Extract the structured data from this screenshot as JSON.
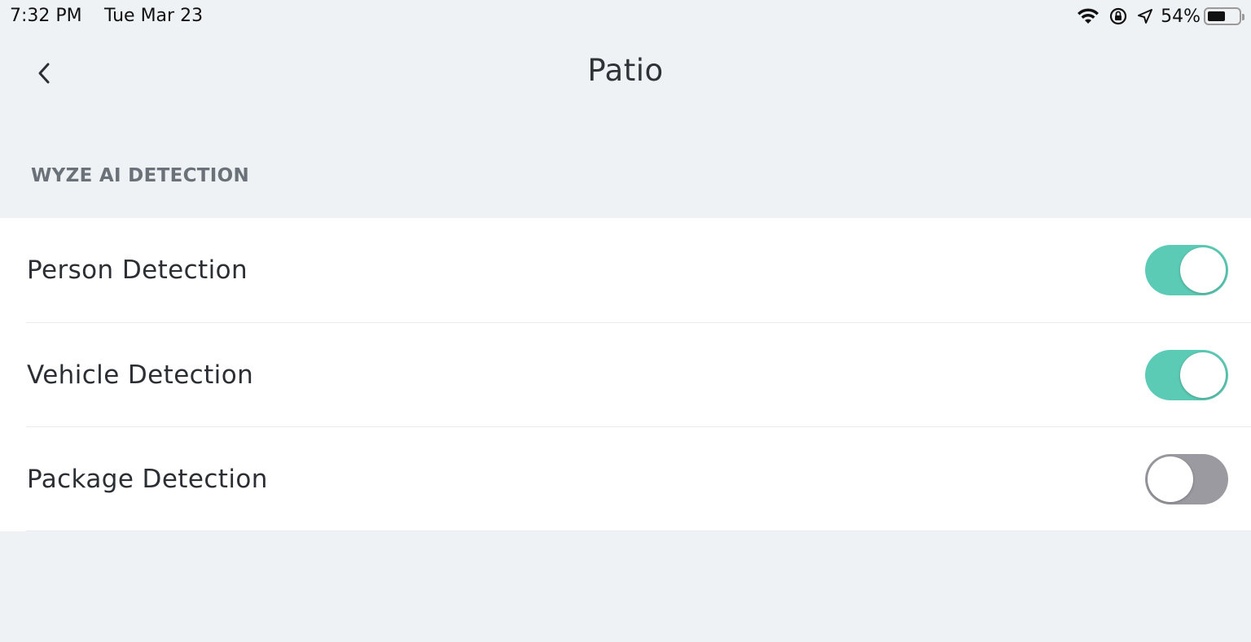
{
  "status_bar": {
    "time": "7:32 PM",
    "date": "Tue Mar 23",
    "battery_percent": "54%",
    "battery_level": 0.54
  },
  "nav": {
    "title": "Patio"
  },
  "section": {
    "title": "WYZE AI DETECTION"
  },
  "settings": [
    {
      "label": "Person Detection",
      "enabled": true
    },
    {
      "label": "Vehicle Detection",
      "enabled": true
    },
    {
      "label": "Package Detection",
      "enabled": false
    }
  ],
  "colors": {
    "toggle_on": "#5ccbb5",
    "toggle_off": "#9a9aa0",
    "background": "#eef2f5"
  }
}
